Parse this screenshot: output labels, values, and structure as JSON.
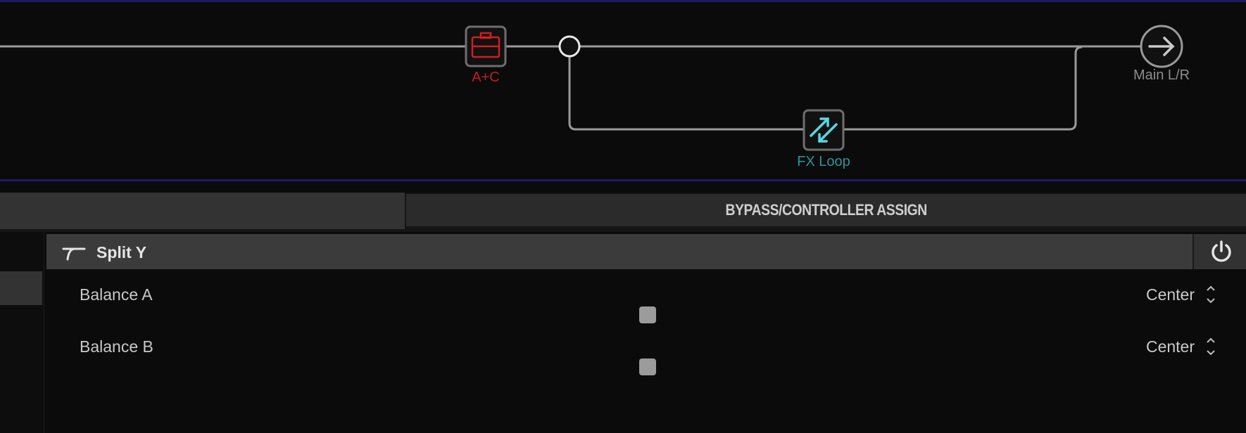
{
  "signal_flow": {
    "blocks": [
      {
        "label": "A+C",
        "icon": "amp-cab-icon",
        "color": "#c21d1d"
      },
      {
        "label": "FX Loop",
        "icon": "fx-loop-icon",
        "color": "#2c9595"
      }
    ],
    "output": {
      "label": "Main L/R",
      "icon": "arrow-right-icon"
    },
    "split_icon": "split-node-icon"
  },
  "tabs": {
    "left_label": "",
    "right_label": "BYPASS/CONTROLLER ASSIGN"
  },
  "block": {
    "title": "Split Y",
    "icon": "split-y-icon",
    "power_icon": "power-icon"
  },
  "params": [
    {
      "label": "Balance A",
      "value": "Center",
      "slider_position": 0.5
    },
    {
      "label": "Balance B",
      "value": "Center",
      "slider_position": 0.5
    }
  ],
  "colors": {
    "background": "#0b0b0c",
    "accent_border": "#1c1b63",
    "amp_red": "#c21d1d",
    "loop_teal": "#2c9595",
    "loop_icon_cyan": "#5ad6df"
  }
}
